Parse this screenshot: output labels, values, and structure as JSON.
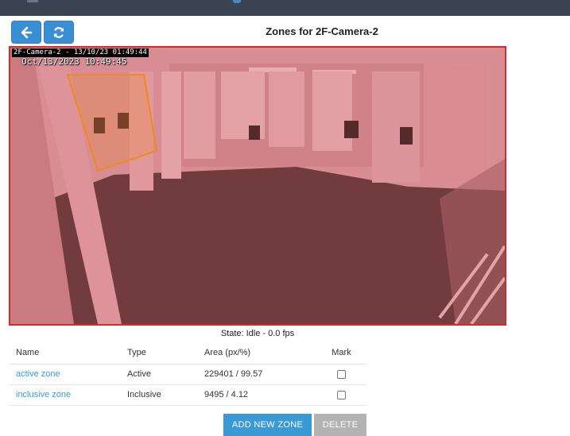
{
  "header": {
    "back_icon": "arrow-left-icon",
    "refresh_icon": "refresh-icon",
    "title": "Zones for 2F-Camera-2"
  },
  "camera": {
    "overlay_timestamp": "2F-Camera-2 - 13/10/23 01:49:44",
    "overlay_clock": "Oct/13/2023 10:49:45",
    "active_zone_color": "#d02a2a",
    "inclusive_zone_color": "#f08a1e"
  },
  "state_text": "State: Idle - 0.0 fps",
  "table": {
    "headers": {
      "name": "Name",
      "type": "Type",
      "area": "Area (px/%)",
      "mark": "Mark"
    },
    "rows": [
      {
        "name": "active zone",
        "type": "Active",
        "area": "229401 / 99.57",
        "marked": false
      },
      {
        "name": "inclusive zone",
        "type": "Inclusive",
        "area": "9495 / 4.12",
        "marked": false
      }
    ]
  },
  "actions": {
    "add_label": "ADD NEW ZONE",
    "delete_label": "DELETE"
  }
}
